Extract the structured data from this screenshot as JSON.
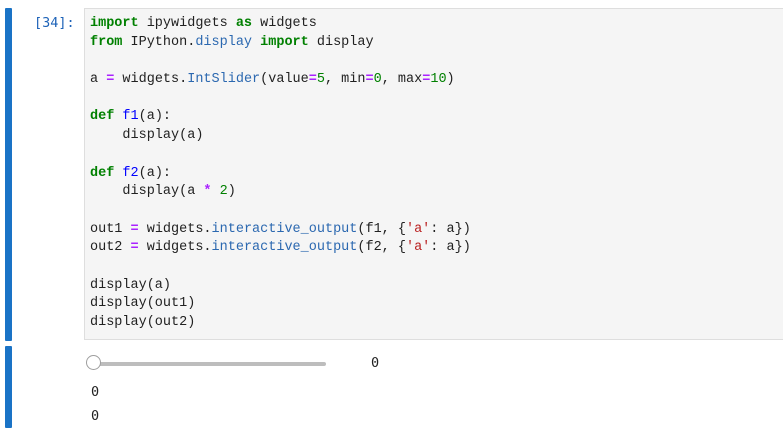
{
  "input_cell": {
    "prompt": "[34]:",
    "code_lines": [
      [
        {
          "t": "import",
          "c": "kw"
        },
        {
          "t": " ipywidgets "
        },
        {
          "t": "as",
          "c": "kw"
        },
        {
          "t": " widgets"
        }
      ],
      [
        {
          "t": "from",
          "c": "kw"
        },
        {
          "t": " IPython."
        },
        {
          "t": "display",
          "c": "attr"
        },
        {
          "t": " "
        },
        {
          "t": "import",
          "c": "kw"
        },
        {
          "t": " display"
        }
      ],
      [],
      [
        {
          "t": "a "
        },
        {
          "t": "=",
          "c": "op"
        },
        {
          "t": " widgets."
        },
        {
          "t": "IntSlider",
          "c": "attr"
        },
        {
          "t": "(value"
        },
        {
          "t": "=",
          "c": "op"
        },
        {
          "t": "5",
          "c": "num"
        },
        {
          "t": ", min"
        },
        {
          "t": "=",
          "c": "op"
        },
        {
          "t": "0",
          "c": "num"
        },
        {
          "t": ", max"
        },
        {
          "t": "=",
          "c": "op"
        },
        {
          "t": "10",
          "c": "num"
        },
        {
          "t": ")"
        }
      ],
      [],
      [
        {
          "t": "def",
          "c": "kw"
        },
        {
          "t": " "
        },
        {
          "t": "f1",
          "c": "fn"
        },
        {
          "t": "(a):"
        }
      ],
      [
        {
          "t": "    display(a)"
        }
      ],
      [],
      [
        {
          "t": "def",
          "c": "kw"
        },
        {
          "t": " "
        },
        {
          "t": "f2",
          "c": "fn"
        },
        {
          "t": "(a):"
        }
      ],
      [
        {
          "t": "    display(a "
        },
        {
          "t": "*",
          "c": "op"
        },
        {
          "t": " "
        },
        {
          "t": "2",
          "c": "num"
        },
        {
          "t": ")"
        }
      ],
      [],
      [
        {
          "t": "out1 "
        },
        {
          "t": "=",
          "c": "op"
        },
        {
          "t": " widgets."
        },
        {
          "t": "interactive_output",
          "c": "attr"
        },
        {
          "t": "(f1, {"
        },
        {
          "t": "'a'",
          "c": "str"
        },
        {
          "t": ": a})"
        }
      ],
      [
        {
          "t": "out2 "
        },
        {
          "t": "=",
          "c": "op"
        },
        {
          "t": " widgets."
        },
        {
          "t": "interactive_output",
          "c": "attr"
        },
        {
          "t": "(f2, {"
        },
        {
          "t": "'a'",
          "c": "str"
        },
        {
          "t": ": a})"
        }
      ],
      [],
      [
        {
          "t": "display(a)"
        }
      ],
      [
        {
          "t": "display(out1)"
        }
      ],
      [
        {
          "t": "display(out2)"
        }
      ]
    ]
  },
  "output_cell": {
    "slider": {
      "value": 0,
      "min": 0,
      "max": 10,
      "readout": "0"
    },
    "out1_text": "0",
    "out2_text": "0"
  },
  "colors": {
    "collapser": "#1a73c6",
    "prompt": "#1e63b8",
    "editor_bg": "#f5f5f5"
  }
}
